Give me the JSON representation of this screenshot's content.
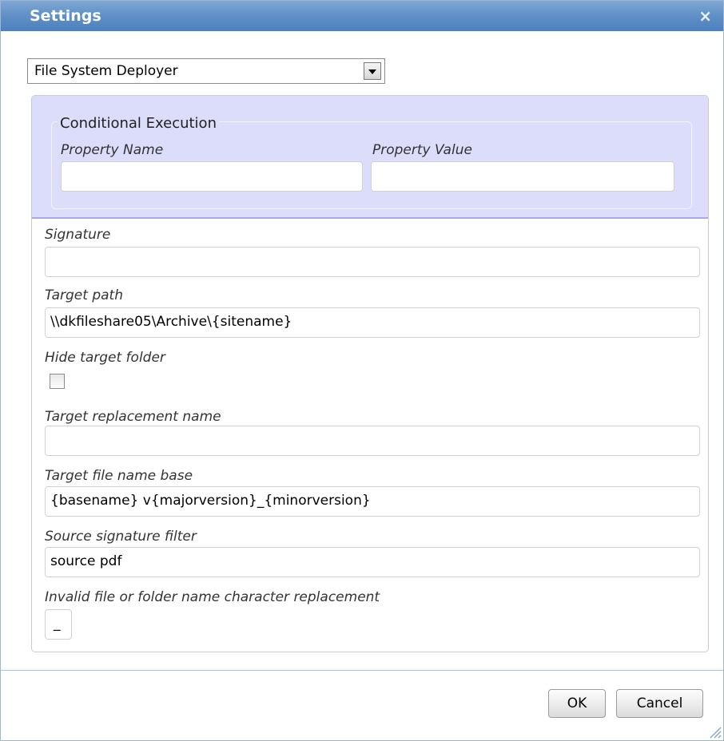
{
  "dialog": {
    "title": "Settings",
    "close_label": "×"
  },
  "deployer_select": {
    "value": "File System Deployer"
  },
  "conditional_execution": {
    "legend": "Conditional Execution",
    "property_name_label": "Property Name",
    "property_name_value": "",
    "property_value_label": "Property Value",
    "property_value_value": ""
  },
  "fields": {
    "signature_label": "Signature",
    "signature_value": "",
    "target_path_label": "Target path",
    "target_path_value": "\\\\dkfileshare05\\Archive\\{sitename}",
    "hide_target_folder_label": "Hide target folder",
    "hide_target_folder_checked": false,
    "target_replacement_name_label": "Target replacement name",
    "target_replacement_name_value": "",
    "target_file_name_base_label": "Target file name base",
    "target_file_name_base_value": "{basename} v{majorversion}_{minorversion}",
    "source_signature_filter_label": "Source signature filter",
    "source_signature_filter_value": "source pdf",
    "invalid_char_replacement_label": "Invalid file or folder name character replacement",
    "invalid_char_replacement_value": "_"
  },
  "buttons": {
    "ok": "OK",
    "cancel": "Cancel"
  },
  "colors": {
    "titlebar": "#5f8fc6",
    "conditional_band": "#dcdcfb"
  }
}
